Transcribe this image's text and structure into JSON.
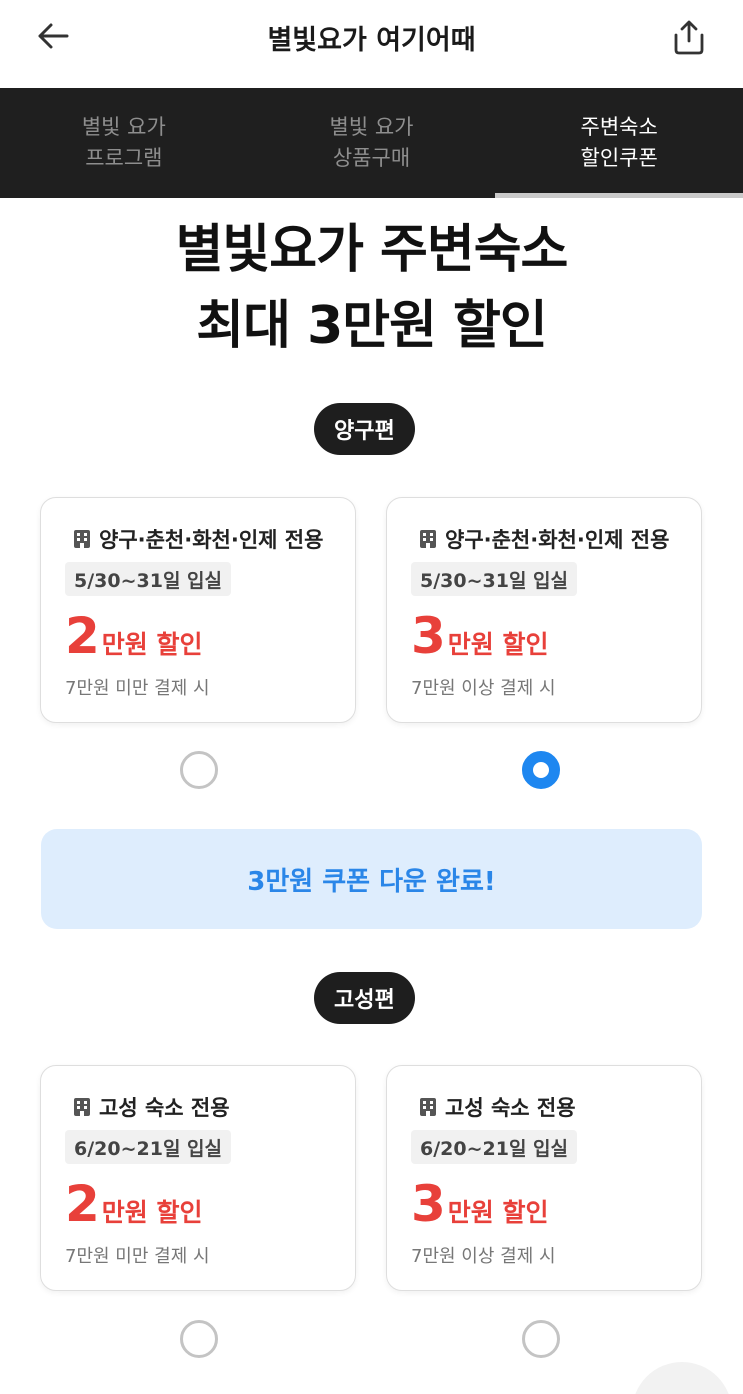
{
  "header": {
    "title": "별빛요가 여기어때",
    "back_icon": "arrow-left-icon",
    "share_icon": "share-icon"
  },
  "tabs": [
    {
      "label": "별빛 요가\n프로그램",
      "active": false
    },
    {
      "label": "별빛 요가\n상품구매",
      "active": false
    },
    {
      "label": "주변숙소\n할인쿠폰",
      "active": true
    }
  ],
  "headline": "별빛요가 주변숙소\n최대 3만원 할인",
  "sections": [
    {
      "pill": "양구편",
      "cards": [
        {
          "region": "양구·춘천·화천·인제 전용",
          "date": "5/30~31일 입실",
          "amount": "2",
          "unit": "만원 할인",
          "condition": "7만원 미만 결제 시",
          "selected": false
        },
        {
          "region": "양구·춘천·화천·인제 전용",
          "date": "5/30~31일 입실",
          "amount": "3",
          "unit": "만원 할인",
          "condition": "7만원 이상 결제 시",
          "selected": true
        }
      ],
      "banner": "3만원 쿠폰 다운 완료!"
    },
    {
      "pill": "고성편",
      "cards": [
        {
          "region": "고성 숙소 전용",
          "date": "6/20~21일 입실",
          "amount": "2",
          "unit": "만원 할인",
          "condition": "7만원 미만 결제 시",
          "selected": false
        },
        {
          "region": "고성 숙소 전용",
          "date": "6/20~21일 입실",
          "amount": "3",
          "unit": "만원 할인",
          "condition": "7만원 이상 결제 시",
          "selected": false
        }
      ]
    }
  ],
  "colors": {
    "accent_red": "#e8403a",
    "accent_blue": "#1e87f0",
    "banner_bg": "#deedfd",
    "tab_bar_bg": "#1f1f1f"
  }
}
